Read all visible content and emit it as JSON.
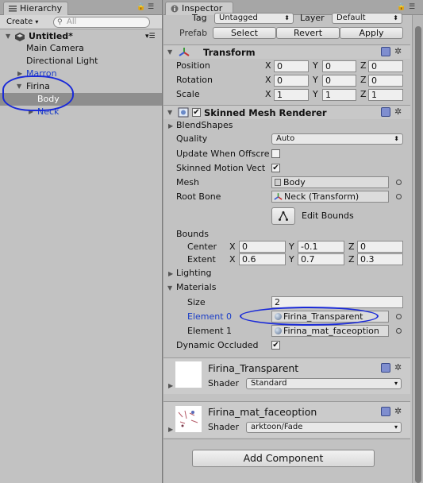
{
  "hierarchy": {
    "tab_label": "Hierarchy",
    "create_label": "Create",
    "search_placeholder": "All",
    "scene_name": "Untitled*",
    "items": [
      {
        "label": "Main Camera"
      },
      {
        "label": "Directional Light"
      },
      {
        "label": "Marron"
      },
      {
        "label": "Firina"
      },
      {
        "label": "Body"
      },
      {
        "label": "Neck"
      }
    ]
  },
  "inspector": {
    "tab_label": "Inspector",
    "tag_label": "Tag",
    "tag_value": "Untagged",
    "layer_label": "Layer",
    "layer_value": "Default",
    "prefab_label": "Prefab",
    "select_label": "Select",
    "revert_label": "Revert",
    "apply_label": "Apply",
    "transform": {
      "title": "Transform",
      "position_label": "Position",
      "rotation_label": "Rotation",
      "scale_label": "Scale",
      "position": {
        "x": "0",
        "y": "0",
        "z": "0"
      },
      "rotation": {
        "x": "0",
        "y": "0",
        "z": "0"
      },
      "scale": {
        "x": "1",
        "y": "1",
        "z": "1"
      }
    },
    "smr": {
      "title": "Skinned Mesh Renderer",
      "blendshapes_label": "BlendShapes",
      "quality_label": "Quality",
      "quality_value": "Auto",
      "update_offscreen_label": "Update When Offscre",
      "skinned_motion_label": "Skinned Motion Vect",
      "mesh_label": "Mesh",
      "mesh_value": "Body",
      "root_bone_label": "Root Bone",
      "root_bone_value": "Neck (Transform)",
      "edit_bounds_label": "Edit Bounds",
      "bounds_label": "Bounds",
      "center_label": "Center",
      "extent_label": "Extent",
      "center": {
        "x": "0",
        "y": "-0.1",
        "z": "0"
      },
      "extent": {
        "x": "0.6",
        "y": "0.7",
        "z": "0.3"
      },
      "lighting_label": "Lighting",
      "materials_label": "Materials",
      "size_label": "Size",
      "size_value": "2",
      "element0_label": "Element 0",
      "element0_value": "Firina_Transparent",
      "element1_label": "Element 1",
      "element1_value": "Firina_mat_faceoption",
      "dynamic_occluded_label": "Dynamic Occluded"
    },
    "materials": [
      {
        "name": "Firina_Transparent",
        "shader_label": "Shader",
        "shader_value": "Standard"
      },
      {
        "name": "Firina_mat_faceoption",
        "shader_label": "Shader",
        "shader_value": "arktoon/Fade"
      }
    ],
    "add_component_label": "Add Component",
    "axis_x": "X",
    "axis_y": "Y",
    "axis_z": "Z"
  },
  "colors": {
    "selection": "#8e8e8e",
    "annotation_ink": "#1a2ad8",
    "link_blue": "#1a3dc7"
  }
}
